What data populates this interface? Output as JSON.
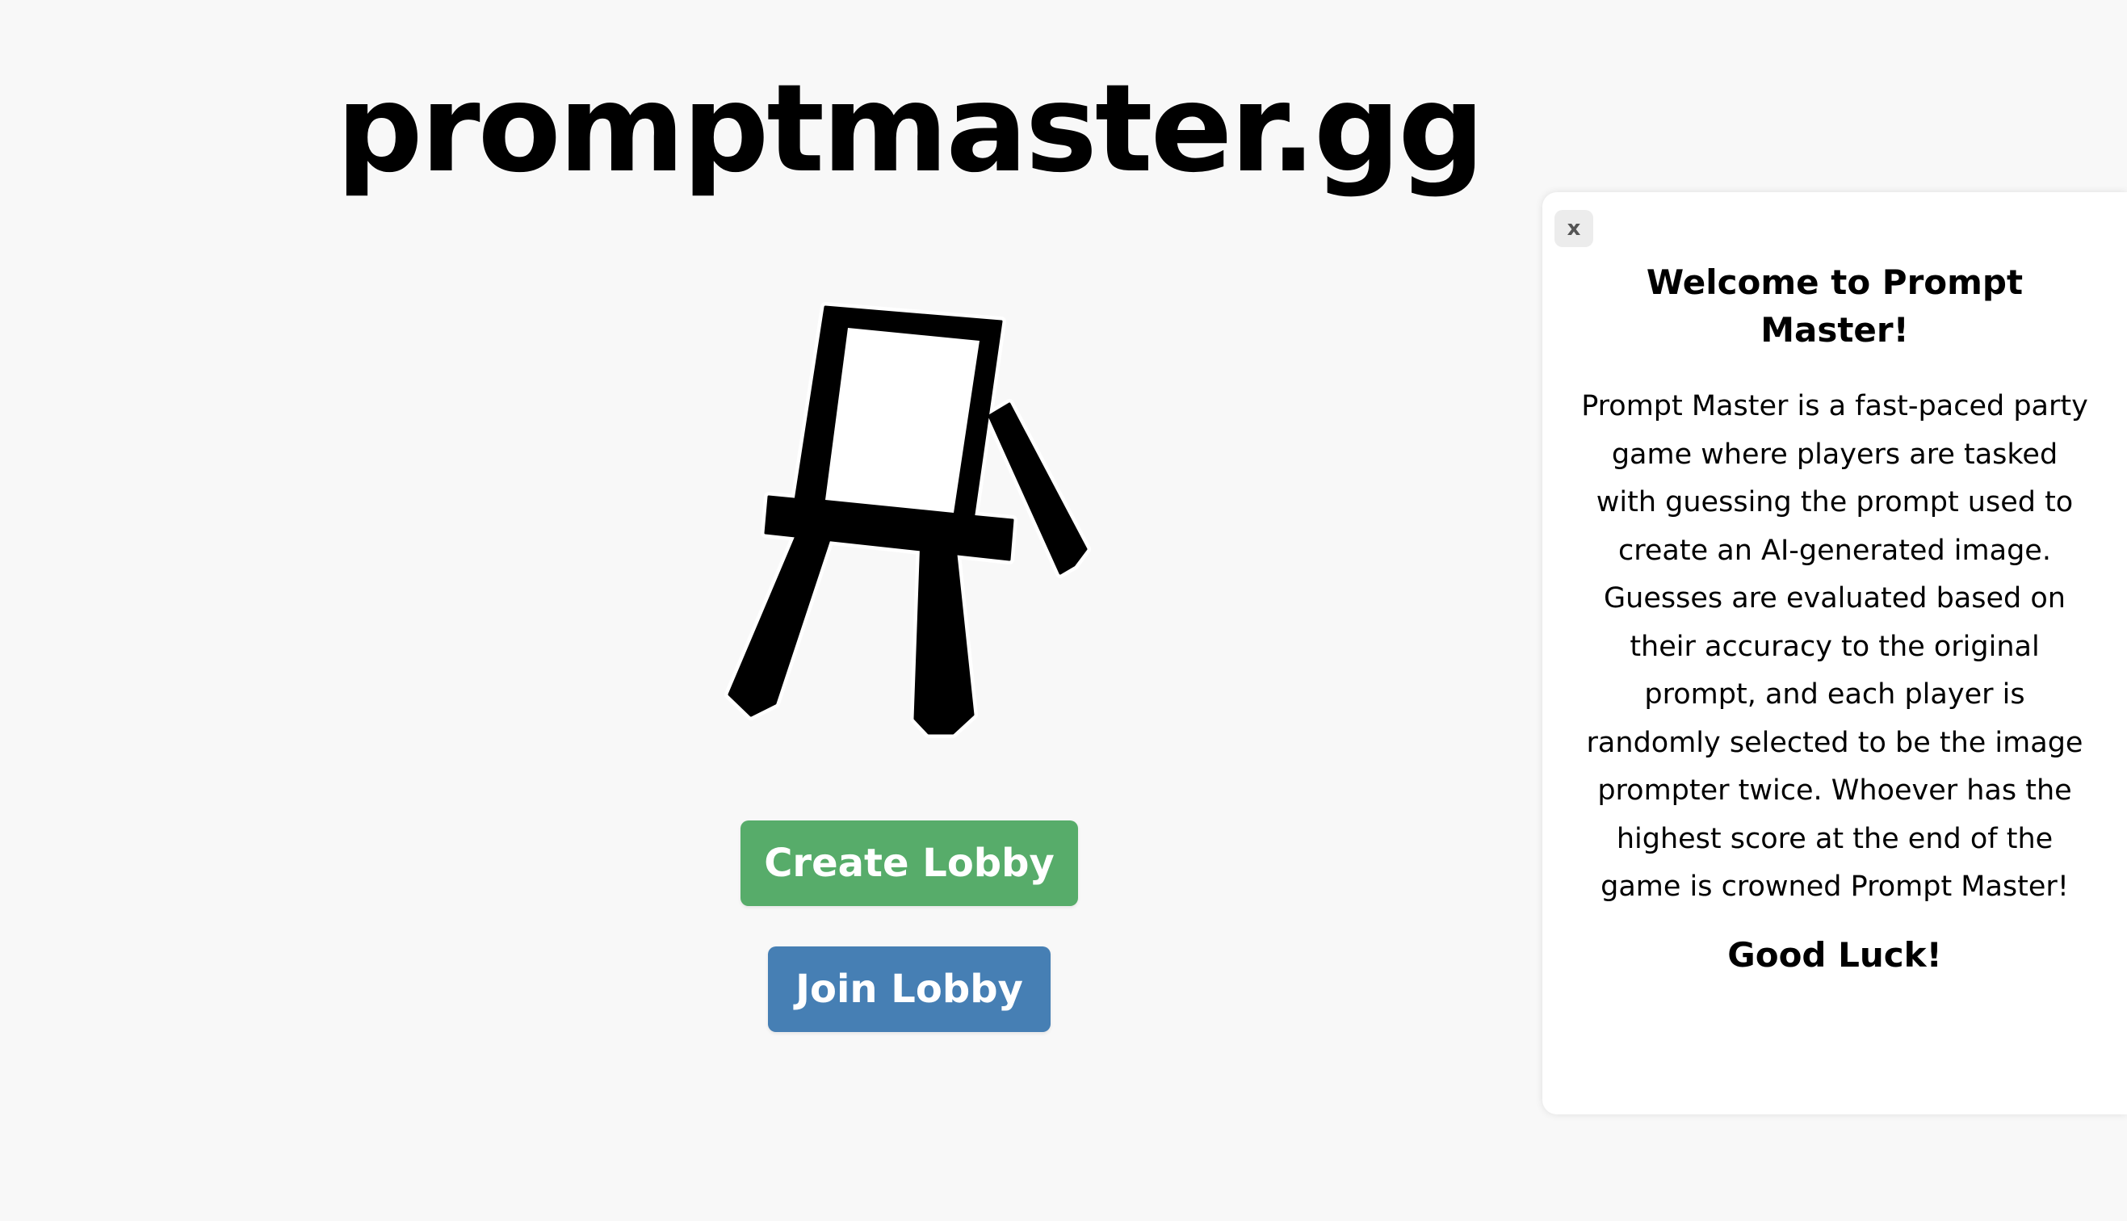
{
  "app": {
    "title": "promptmaster.gg"
  },
  "logo": {
    "icon": "easel-icon"
  },
  "actions": {
    "create_label": "Create Lobby",
    "join_label": "Join Lobby"
  },
  "colors": {
    "create_button": "#57ac6a",
    "join_button": "#467fb4",
    "background": "#f8f8f8",
    "panel": "#ffffff"
  },
  "welcome_panel": {
    "close_label": "x",
    "title": "Welcome to Prompt Master!",
    "body": "Prompt Master is a fast-paced party game where players are tasked with guessing the prompt used to create an AI-generated image. Guesses are evaluated based on their accuracy to the original prompt, and each player is randomly selected to be the image prompter twice. Whoever has the highest score at the end of the game is crowned Prompt Master!",
    "footer": "Good Luck!"
  }
}
